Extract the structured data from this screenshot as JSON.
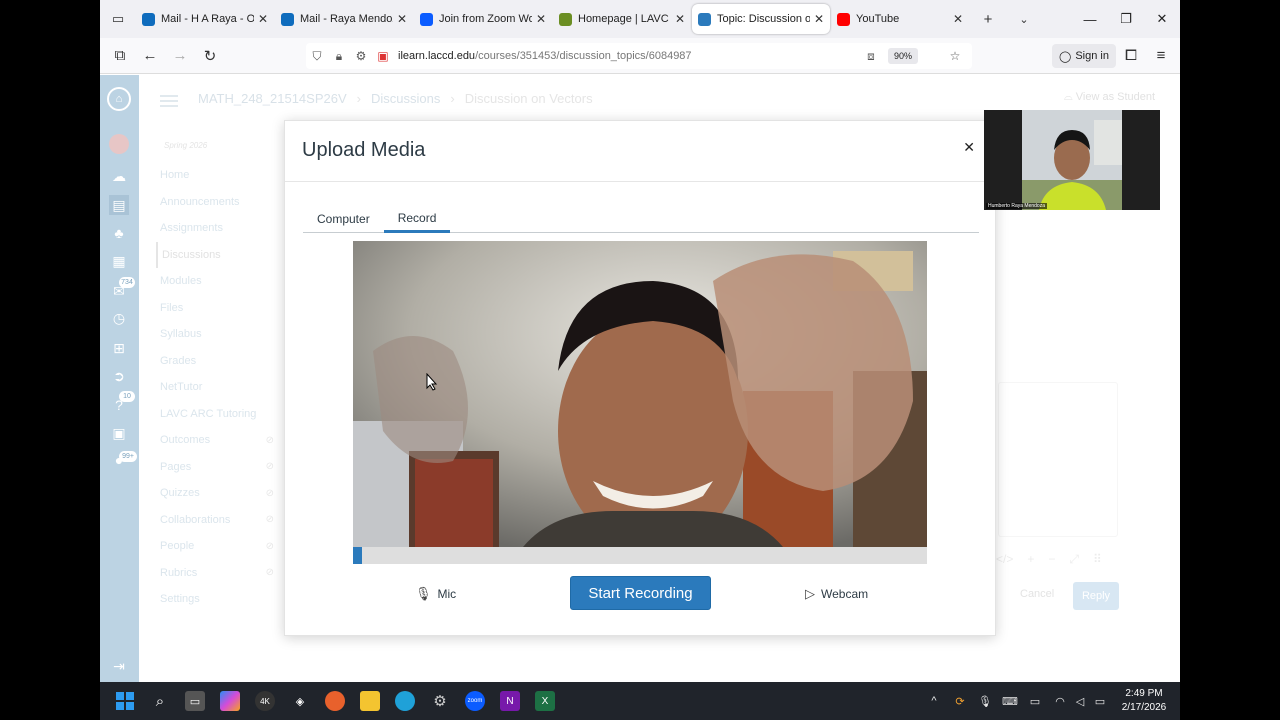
{
  "browser": {
    "tabs": [
      {
        "title": "Mail - H A Raya - Outl",
        "icon": "outlook-icon",
        "color": "#0f6cbd"
      },
      {
        "title": "Mail - Raya Mendoza,",
        "icon": "outlook-icon",
        "color": "#0f6cbd"
      },
      {
        "title": "Join from Zoom Work",
        "icon": "zoom-icon",
        "color": "#0b5cff"
      },
      {
        "title": "Homepage | LAVC",
        "icon": "lavc-icon",
        "color": "#6b8e23"
      },
      {
        "title": "Topic: Discussion on V",
        "icon": "canvas-icon",
        "color": "#2b7abc"
      },
      {
        "title": "YouTube",
        "icon": "youtube-icon",
        "color": "#ff0000"
      }
    ],
    "active_tab_index": 4,
    "url_domain": "ilearn.laccd.edu",
    "url_path": "/courses/351453/discussion_topics/6084987",
    "zoom_level": "90%",
    "signin_label": "Sign in"
  },
  "canvas": {
    "breadcrumbs": [
      "MATH_248_21514SP26V",
      "Discussions",
      "Discussion on Vectors"
    ],
    "view_as_student": "View as Student",
    "term": "Spring 2026",
    "course_nav": [
      {
        "label": "Home",
        "hidden": false
      },
      {
        "label": "Announcements",
        "hidden": false
      },
      {
        "label": "Assignments",
        "hidden": false
      },
      {
        "label": "Discussions",
        "hidden": false,
        "active": true
      },
      {
        "label": "Modules",
        "hidden": false
      },
      {
        "label": "Files",
        "hidden": false
      },
      {
        "label": "Syllabus",
        "hidden": false
      },
      {
        "label": "Grades",
        "hidden": false
      },
      {
        "label": "NetTutor",
        "hidden": false
      },
      {
        "label": "LAVC ARC Tutoring",
        "hidden": false
      },
      {
        "label": "Outcomes",
        "hidden": true
      },
      {
        "label": "Pages",
        "hidden": true
      },
      {
        "label": "Quizzes",
        "hidden": true
      },
      {
        "label": "Collaborations",
        "hidden": true
      },
      {
        "label": "People",
        "hidden": true
      },
      {
        "label": "Rubrics",
        "hidden": true
      },
      {
        "label": "Settings",
        "hidden": false
      }
    ],
    "global_nav_badges": {
      "inbox": "734",
      "calendar": "10",
      "help": "99+"
    },
    "cancel_label": "Cancel",
    "reply_label": "Reply"
  },
  "modal": {
    "title": "Upload Media",
    "tabs": [
      "Computer",
      "Record"
    ],
    "selected_tab": "Record",
    "mic_label": "Mic",
    "start_label": "Start Recording",
    "webcam_label": "Webcam",
    "recording_progress": 0.015
  },
  "zoom_selfview": {
    "name": "Humberto Raya Mendoza"
  },
  "taskbar": {
    "time": "2:49 PM",
    "date": "2/17/2026",
    "accent": "#2b7abc"
  }
}
